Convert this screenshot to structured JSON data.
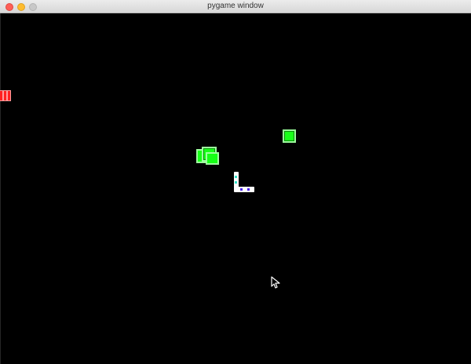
{
  "window": {
    "title": "pygame window"
  },
  "colors": {
    "background": "#000000",
    "titlebar": "#dedede",
    "red": "#ff2020",
    "green": "#19ff19",
    "white": "#ffffff",
    "teal": "#34e4c9",
    "purple": "#4a1de9",
    "close_button": "#fe5f57",
    "minimize_button": "#febc2e",
    "zoom_button": "#c8c8c8"
  },
  "icons": {
    "close": "close-dot-icon",
    "minimize": "minimize-dot-icon",
    "zoom": "zoom-dot-icon",
    "cursor": "mouse-pointer-icon"
  }
}
